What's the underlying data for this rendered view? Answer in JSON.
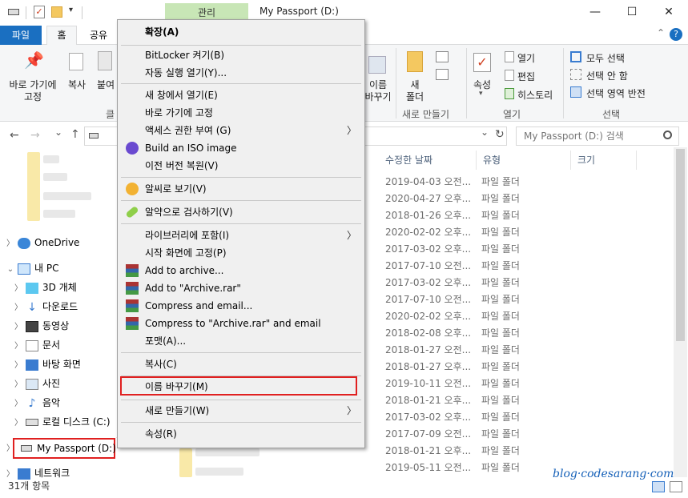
{
  "window": {
    "title": "My Passport (D:)",
    "context_tab": "관리",
    "min_glyph": "—",
    "max_glyph": "☐",
    "close_glyph": "✕",
    "help_glyph": "?",
    "collapse_glyph": "⌃"
  },
  "ribbon": {
    "tabs": [
      "파일",
      "홈",
      "공유"
    ],
    "pin_label_1": "바로 가기에",
    "pin_label_2": "고정",
    "copy_label": "복사",
    "paste_label": "붙여",
    "group_clipboard": "클",
    "move_label_1": "이름",
    "move_label_2": "바꾸기",
    "new_folder_1": "새",
    "new_folder_2": "폴더",
    "group_new": "새로 만들기",
    "properties": "속성",
    "open": "열기",
    "edit": "편집",
    "history": "히스토리",
    "group_open": "열기",
    "select_all": "모두 선택",
    "select_none": "선택 안 함",
    "invert": "선택 영역 반전",
    "group_select": "선택"
  },
  "address": {
    "search_placeholder": "My Passport (D:) 검색",
    "refresh_glyph": "↻",
    "dropdown_glyph": "⌄",
    "back_glyph": "←",
    "forward_glyph": "→",
    "recent_glyph": "⌄",
    "up_glyph": "↑"
  },
  "columns": {
    "date": "수정한 날짜",
    "type": "유형",
    "size": "크기"
  },
  "rows": [
    {
      "date": "2019-04-03 오전...",
      "type": "파일 폴더"
    },
    {
      "date": "2020-04-27 오후...",
      "type": "파일 폴더"
    },
    {
      "date": "2018-01-26 오후...",
      "type": "파일 폴더"
    },
    {
      "date": "2020-02-02 오후...",
      "type": "파일 폴더"
    },
    {
      "date": "2017-03-02 오후...",
      "type": "파일 폴더"
    },
    {
      "date": "2017-07-10 오전...",
      "type": "파일 폴더"
    },
    {
      "date": "2017-03-02 오후...",
      "type": "파일 폴더"
    },
    {
      "date": "2017-07-10 오전...",
      "type": "파일 폴더"
    },
    {
      "date": "2020-02-02 오후...",
      "type": "파일 폴더"
    },
    {
      "date": "2018-02-08 오후...",
      "type": "파일 폴더"
    },
    {
      "date": "2018-01-27 오전...",
      "type": "파일 폴더"
    },
    {
      "date": "2018-01-27 오후...",
      "type": "파일 폴더"
    },
    {
      "date": "2019-10-11 오전...",
      "type": "파일 폴더"
    },
    {
      "date": "2018-01-21 오후...",
      "type": "파일 폴더"
    },
    {
      "date": "2017-03-02 오후...",
      "type": "파일 폴더"
    },
    {
      "date": "2017-07-09 오전...",
      "type": "파일 폴더"
    },
    {
      "date": "2018-01-21 오후...",
      "type": "파일 폴더"
    },
    {
      "date": "2019-05-11 오전...",
      "type": "파일 폴더"
    }
  ],
  "nav": {
    "onedrive": "OneDrive",
    "thispc": "내 PC",
    "obj3d": "3D 개체",
    "downloads": "다운로드",
    "videos": "동영상",
    "documents": "문서",
    "desktop": "바탕 화면",
    "pictures": "사진",
    "music": "음악",
    "localdisk": "로컬 디스크 (C:)",
    "passport": "My Passport (D:)",
    "network": "네트워크"
  },
  "menu": {
    "expand": "확장(A)",
    "bitlocker": "BitLocker 켜기(B)",
    "autoplay": "자동 실행 열기(Y)...",
    "newwindow": "새 창에서 열기(E)",
    "pinquick": "바로 가기에 고정",
    "access": "액세스 권한 부여 (G)",
    "iso": "Build an ISO image",
    "restore": "이전 버전 복원(V)",
    "alsee": "알씨로 보기(V)",
    "alyac": "알약으로 검사하기(V)",
    "library": "라이브러리에 포함(I)",
    "pinstart": "시작 화면에 고정(P)",
    "addarchive": "Add to archive...",
    "addrar": "Add to \"Archive.rar\"",
    "compressemail": "Compress and email...",
    "compressrar": "Compress to \"Archive.rar\" and email",
    "format": "포맷(A)...",
    "copy": "복사(C)",
    "rename": "이름 바꾸기(M)",
    "newitem": "새로 만들기(W)",
    "properties": "속성(R)",
    "arrow": "〉"
  },
  "status": {
    "items": "31개 항목"
  },
  "watermark": "blog·codesarang·com",
  "colors": {
    "accent": "#1a6fc1",
    "highlight": "#e02020",
    "context_tab": "#c8e6b6"
  }
}
